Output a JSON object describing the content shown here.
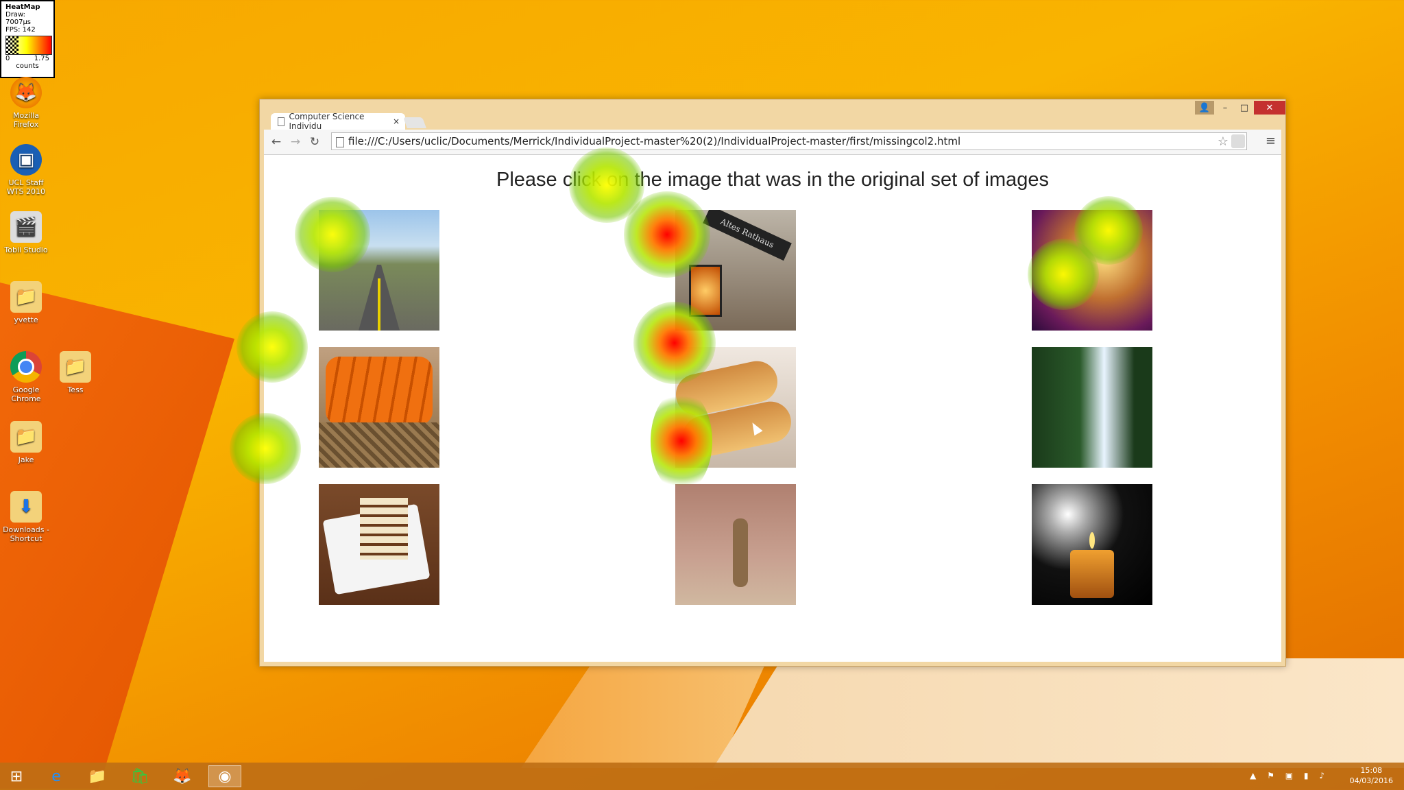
{
  "heatmap_legend": {
    "title": "HeatMap",
    "draw": "Draw: 7007μs",
    "fps": "FPS: 142",
    "min": "0",
    "max": "1.75",
    "unit": "counts",
    "colors": [
      "#ffffff",
      "#ffff00",
      "#ff0000"
    ]
  },
  "desktop": {
    "icons": [
      {
        "label": "Mozilla Firefox",
        "icon": "firefox-icon"
      },
      {
        "label": "UCL Staff WTS 2010",
        "icon": "remote-desktop-icon"
      },
      {
        "label": "Tobii Studio",
        "icon": "tobii-studio-icon"
      },
      {
        "label": "yvette",
        "icon": "folder-icon"
      },
      {
        "label": "Google Chrome",
        "icon": "chrome-icon"
      },
      {
        "label": "Tess",
        "icon": "folder-icon"
      },
      {
        "label": "Jake",
        "icon": "folder-icon"
      },
      {
        "label": "Downloads - Shortcut",
        "icon": "folder-shortcut-icon"
      }
    ]
  },
  "browser": {
    "tab_title": "Computer Science Individu",
    "tab_close": "×",
    "url": "file:///C:/Users/uclic/Documents/Merrick/IndividualProject-master%20(2)/IndividualProject-master/first/missingcol2.html",
    "controls": {
      "minimize": "–",
      "maximize": "□",
      "close": "✕"
    }
  },
  "page": {
    "heading": "Please click on the image that was in the original set of images",
    "images": [
      {
        "subject": "road",
        "icon": "road-image"
      },
      {
        "subject": "lantern",
        "icon": "lantern-image"
      },
      {
        "subject": "saxophone",
        "icon": "saxophone-image"
      },
      {
        "subject": "carrots",
        "icon": "carrots-image"
      },
      {
        "subject": "bread",
        "icon": "bread-image"
      },
      {
        "subject": "waterfall",
        "icon": "waterfall-image"
      },
      {
        "subject": "cake",
        "icon": "cake-image"
      },
      {
        "subject": "meerkat",
        "icon": "meerkat-image"
      },
      {
        "subject": "candle",
        "icon": "candle-image"
      }
    ]
  },
  "heat_level": {
    "hot": "#ff0000",
    "warm": "#ffff00",
    "cool": "#80c800"
  },
  "taskbar": {
    "items": [
      {
        "name": "start",
        "icon": "windows-start-icon"
      },
      {
        "name": "internet-explorer",
        "icon": "internet-explorer-icon"
      },
      {
        "name": "file-explorer",
        "icon": "file-explorer-icon"
      },
      {
        "name": "store",
        "icon": "store-icon"
      },
      {
        "name": "firefox",
        "icon": "firefox-icon"
      },
      {
        "name": "chrome",
        "icon": "chrome-icon"
      }
    ],
    "time": "15:08",
    "date": "04/03/2016"
  }
}
